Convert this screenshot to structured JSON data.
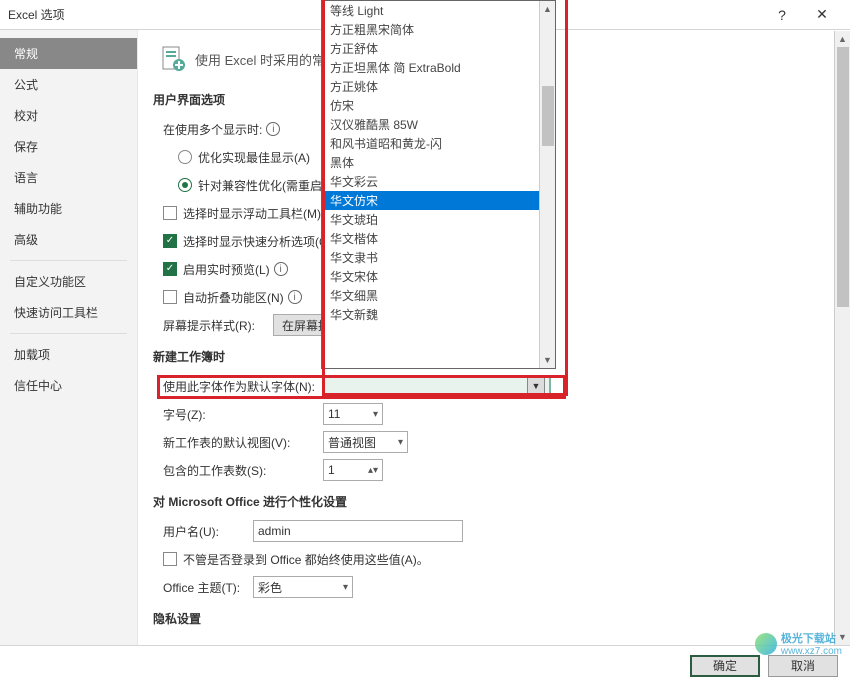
{
  "titlebar": {
    "title": "Excel 选项"
  },
  "sidebar": {
    "items": [
      "常规",
      "公式",
      "校对",
      "保存",
      "语言",
      "辅助功能",
      "高级",
      "自定义功能区",
      "快速访问工具栏",
      "加载项",
      "信任中心"
    ],
    "active_index": 0
  },
  "heading": "使用 Excel 时采用的常",
  "section_ui": {
    "title": "用户界面选项"
  },
  "multi_display": {
    "label": "在使用多个显示时:"
  },
  "radio_best": {
    "label": "优化实现最佳显示(A)"
  },
  "radio_compat": {
    "label": "针对兼容性优化(需重启"
  },
  "chk_float": {
    "label": "选择时显示浮动工具栏(M)"
  },
  "chk_quick": {
    "label": "选择时显示快速分析选项(Q"
  },
  "chk_preview": {
    "label": "启用实时预览(L)"
  },
  "chk_collapse": {
    "label": "自动折叠功能区(N)"
  },
  "tip_style": {
    "label": "屏幕提示样式(R):",
    "button": "在屏幕提示"
  },
  "section_newbook": {
    "title": "新建工作簿时"
  },
  "font_default": {
    "label": "使用此字体作为默认字体(N):",
    "value": ""
  },
  "font_size": {
    "label": "字号(Z):",
    "value": "11"
  },
  "default_view": {
    "label": "新工作表的默认视图(V):",
    "value": "普通视图"
  },
  "sheet_count": {
    "label": "包含的工作表数(S):",
    "value": "1"
  },
  "section_pers": {
    "title": "对 Microsoft Office 进行个性化设置"
  },
  "username": {
    "label": "用户名(U):",
    "value": "admin"
  },
  "chk_always": {
    "label": "不管是否登录到 Office 都始终使用这些值(A)。"
  },
  "theme": {
    "label": "Office 主题(T):",
    "value": "彩色"
  },
  "section_privacy": {
    "title": "隐私设置"
  },
  "footer": {
    "ok": "确定",
    "cancel": "取消"
  },
  "dropdown": {
    "options": [
      "等线 Light",
      "方正粗黑宋简体",
      "方正舒体",
      "方正坦黑体 简 ExtraBold",
      "方正姚体",
      "仿宋",
      "汉仪雅酷黑 85W",
      "和风书道昭和黄龙-闪",
      "黑体",
      "华文彩云",
      "华文仿宋",
      "华文琥珀",
      "华文楷体",
      "华文隶书",
      "华文宋体",
      "华文细黑",
      "华文新魏"
    ],
    "selected_index": 10
  },
  "watermark": {
    "text": "极光下载站",
    "url": "www.xz7.com"
  }
}
